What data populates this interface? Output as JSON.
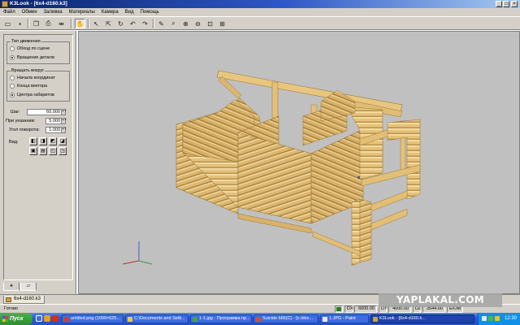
{
  "window": {
    "title": "K3Look - [6x4-d160.k3]",
    "controls": [
      "_",
      "□",
      "×"
    ]
  },
  "menu": [
    "Файл",
    "Обмен",
    "Заливка",
    "Материалы",
    "Камера",
    "Вид",
    "Помощь"
  ],
  "toolbar": {
    "buttons": [
      "open-icon",
      "save-icon",
      "copy-icon",
      "print-icon",
      "split-icon",
      "hand-icon",
      "select-icon",
      "select-move-icon",
      "rotate-icon",
      "undo-icon",
      "redo-icon",
      "pencil-icon",
      "zoom-icon",
      "zoom-in-icon",
      "zoom-out-icon",
      "zoom-window-icon",
      "zoom-all-icon"
    ],
    "pressed": "hand-icon"
  },
  "panel": {
    "motion_group": "Тип движения",
    "motion_options": [
      "Обход по сцене",
      "Вращение детали"
    ],
    "motion_selected": 1,
    "rotate_group": "Вращать вокруг",
    "rotate_options": [
      "Начала координат",
      "Конца вектора",
      "Центра габаритов"
    ],
    "rotate_selected": 2,
    "step_label": "Шаг:",
    "step_value": "60.000",
    "press_label": "При указании:",
    "press_value": "5.000",
    "angle_label": "Угол поворота:",
    "angle_value": "1.000",
    "view_label": "Вид:",
    "view_buttons": [
      "view-front-icon",
      "view-back-icon",
      "view-left-icon",
      "view-right-icon",
      "view-top-icon",
      "view-bottom-icon",
      "view-iso-icon",
      "view-iso2-icon"
    ],
    "tabs": [
      "tree-tab-icon",
      "folder-tab-icon"
    ]
  },
  "document_tab": "6x4-d160.k3",
  "status": {
    "ready": "Готово",
    "dx_label": "DX:",
    "dx_value": "6000.00",
    "dy_label": "DY:",
    "dy_value": "4000.00",
    "dz_label": "DZ:",
    "dz_value": "3544.00",
    "mode": "E/OM"
  },
  "watermark": "YAPLAKAL.COM",
  "taskbar": {
    "start": "Пуск",
    "tasks": [
      {
        "label": "untitled.png (1000×625...",
        "color": "#d83a2a"
      },
      {
        "label": "C:\\Documents and Setti...",
        "color": "#f0c840"
      },
      {
        "label": "1-1.jpg - Программа пр...",
        "color": "#48a048"
      },
      {
        "label": "Suicide 666(C) - [c:/doc...",
        "color": "#d85030"
      },
      {
        "label": "1.JPG - Paint",
        "color": "#e8e8e8"
      },
      {
        "label": "K3Look - [6x4-d160.k...",
        "color": "#c8a050",
        "active": true
      }
    ],
    "clock": "12:30"
  },
  "colors": {
    "log_light": "#f0d08a",
    "log_mid": "#d9b468",
    "log_dark": "#b89040",
    "viewport_bg": "#c0c0c0"
  }
}
